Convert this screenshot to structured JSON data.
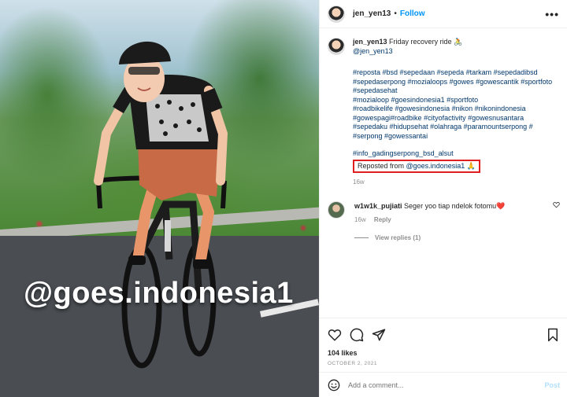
{
  "post": {
    "author": "jen_yen13",
    "follow_label": "Follow",
    "dot": "•",
    "more": "•••",
    "caption_text": "Friday recovery ride 🚴",
    "caption_handle": "@jen_yen13",
    "hashtags": [
      "#reposta #bsd #sepedaan #sepeda #tarkam #sepedadibsd",
      "#sepedaserpong #mozialoops #gowes #gowescantik #sportfoto",
      "#sepedasehat",
      "#mozialoop #goesindonesia1 #sportfoto",
      "#roadbikelife #gowesindonesia #nikon #nikonindonesia",
      "#gowespagi#roadbike #cityofactivity #gowesnusantara",
      "#sepedaku #hidupsehat #olahraga #paramountserpong #",
      "#serpong #gowessantai"
    ],
    "hashtags_tail": "#info_gadingserpong_bsd_alsut",
    "repost_prefix": "Reposted from ",
    "repost_handle": "@goes.indonesia1",
    "repost_emoji": "🙏",
    "caption_age": "16w"
  },
  "comment": {
    "user": "w1w1k_pujiati",
    "text": "Seger yoo tiap ndelok fotomu❤️",
    "age": "16w",
    "reply_label": "Reply",
    "view_replies": "View replies (1)"
  },
  "footer": {
    "likes": "104 likes",
    "date": "OCTOBER 2, 2021",
    "comment_placeholder": "Add a comment...",
    "post_label": "Post"
  },
  "photo": {
    "watermark": "@goes.indonesia1"
  },
  "colors": {
    "link": "#0095f6",
    "hashtag": "#00376b",
    "highlight_box": "#e02020",
    "arrow": "#e02020"
  },
  "icons": [
    "more-icon",
    "heart-icon",
    "comment-icon",
    "share-icon",
    "save-icon",
    "emoji-icon",
    "small-heart-icon"
  ]
}
